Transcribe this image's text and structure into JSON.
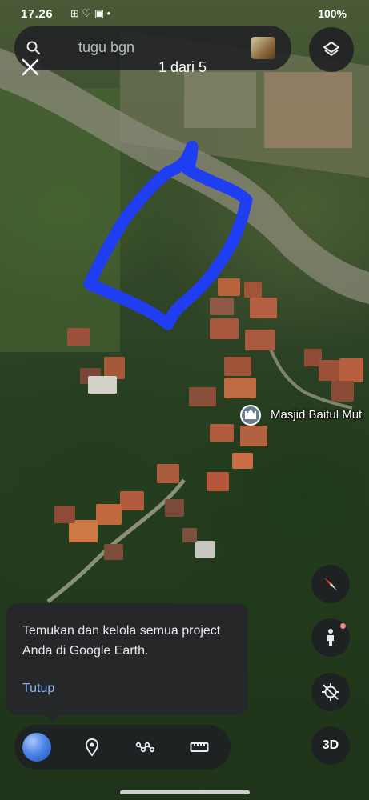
{
  "status_bar": {
    "time": "17.26",
    "notif_icons": "⊞ ♡ ▣ •",
    "right_text": "100%"
  },
  "search": {
    "query": "tugu bgn",
    "result_counter": "1 dari 5"
  },
  "map": {
    "poi_label": "Masjid Baitul Mut",
    "drawing_color": "#1f3ef2"
  },
  "tooltip": {
    "message": "Temukan dan kelola semua project Anda di Google Earth.",
    "dismiss_label": "Tutup"
  },
  "controls": {
    "view_3d_label": "3D"
  },
  "icons": {
    "search": "search-icon",
    "close": "close-icon",
    "layers": "layers-icon",
    "compass": "compass-icon",
    "pegman": "pegman-icon",
    "location": "location-off-icon",
    "place": "pin-icon",
    "path": "path-icon",
    "measure": "ruler-icon",
    "projects": "globe-icon"
  },
  "colors": {
    "panel_bg": "#202124",
    "accent_blue": "#8ab4f8",
    "compass_red": "#ea4335"
  }
}
